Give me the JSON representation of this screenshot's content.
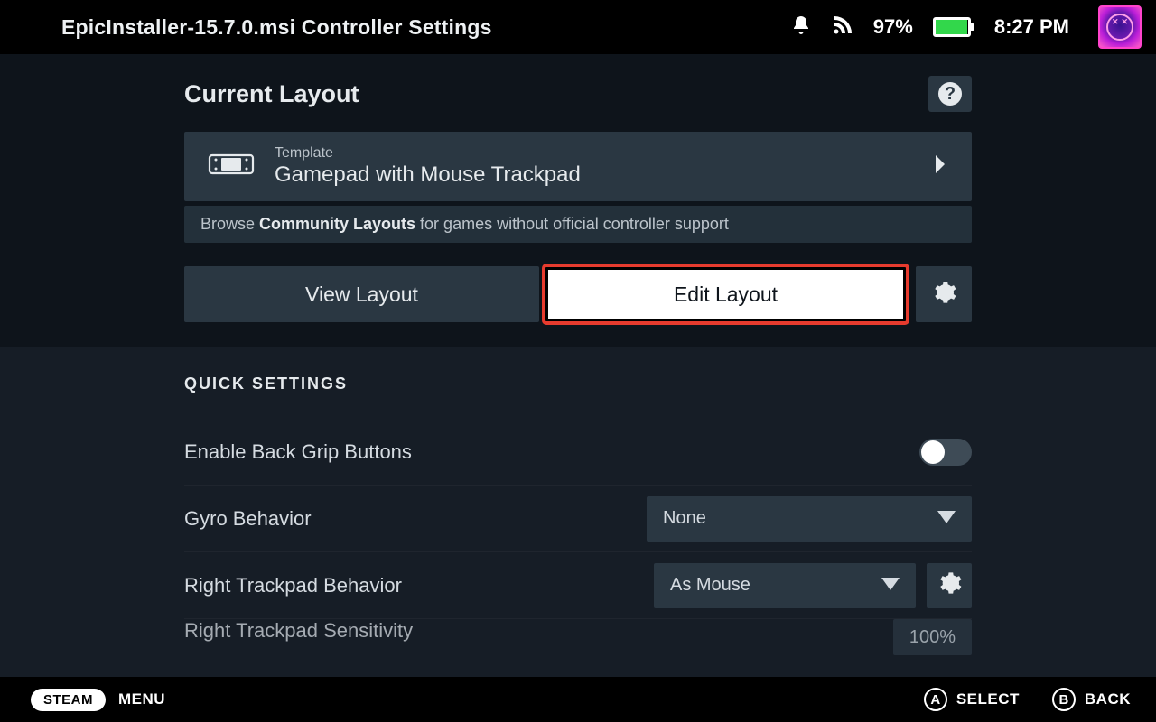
{
  "topbar": {
    "title": "EpicInstaller-15.7.0.msi Controller Settings",
    "battery_pct": "97%",
    "time": "8:27 PM"
  },
  "current_layout": {
    "heading": "Current Layout",
    "template_label": "Template",
    "template_name": "Gamepad with Mouse Trackpad",
    "community_prefix": "Browse ",
    "community_bold": "Community Layouts",
    "community_suffix": " for games without official controller support",
    "view_btn": "View Layout",
    "edit_btn": "Edit Layout"
  },
  "quick": {
    "heading": "QUICK SETTINGS",
    "rows": [
      {
        "label": "Enable Back Grip Buttons"
      },
      {
        "label": "Gyro Behavior",
        "value": "None"
      },
      {
        "label": "Right Trackpad Behavior",
        "value": "As Mouse"
      },
      {
        "label": "Right Trackpad Sensitivity",
        "value": "100%"
      }
    ]
  },
  "footer": {
    "steam": "STEAM",
    "menu": "MENU",
    "a": "A",
    "a_label": "SELECT",
    "b": "B",
    "b_label": "BACK"
  }
}
